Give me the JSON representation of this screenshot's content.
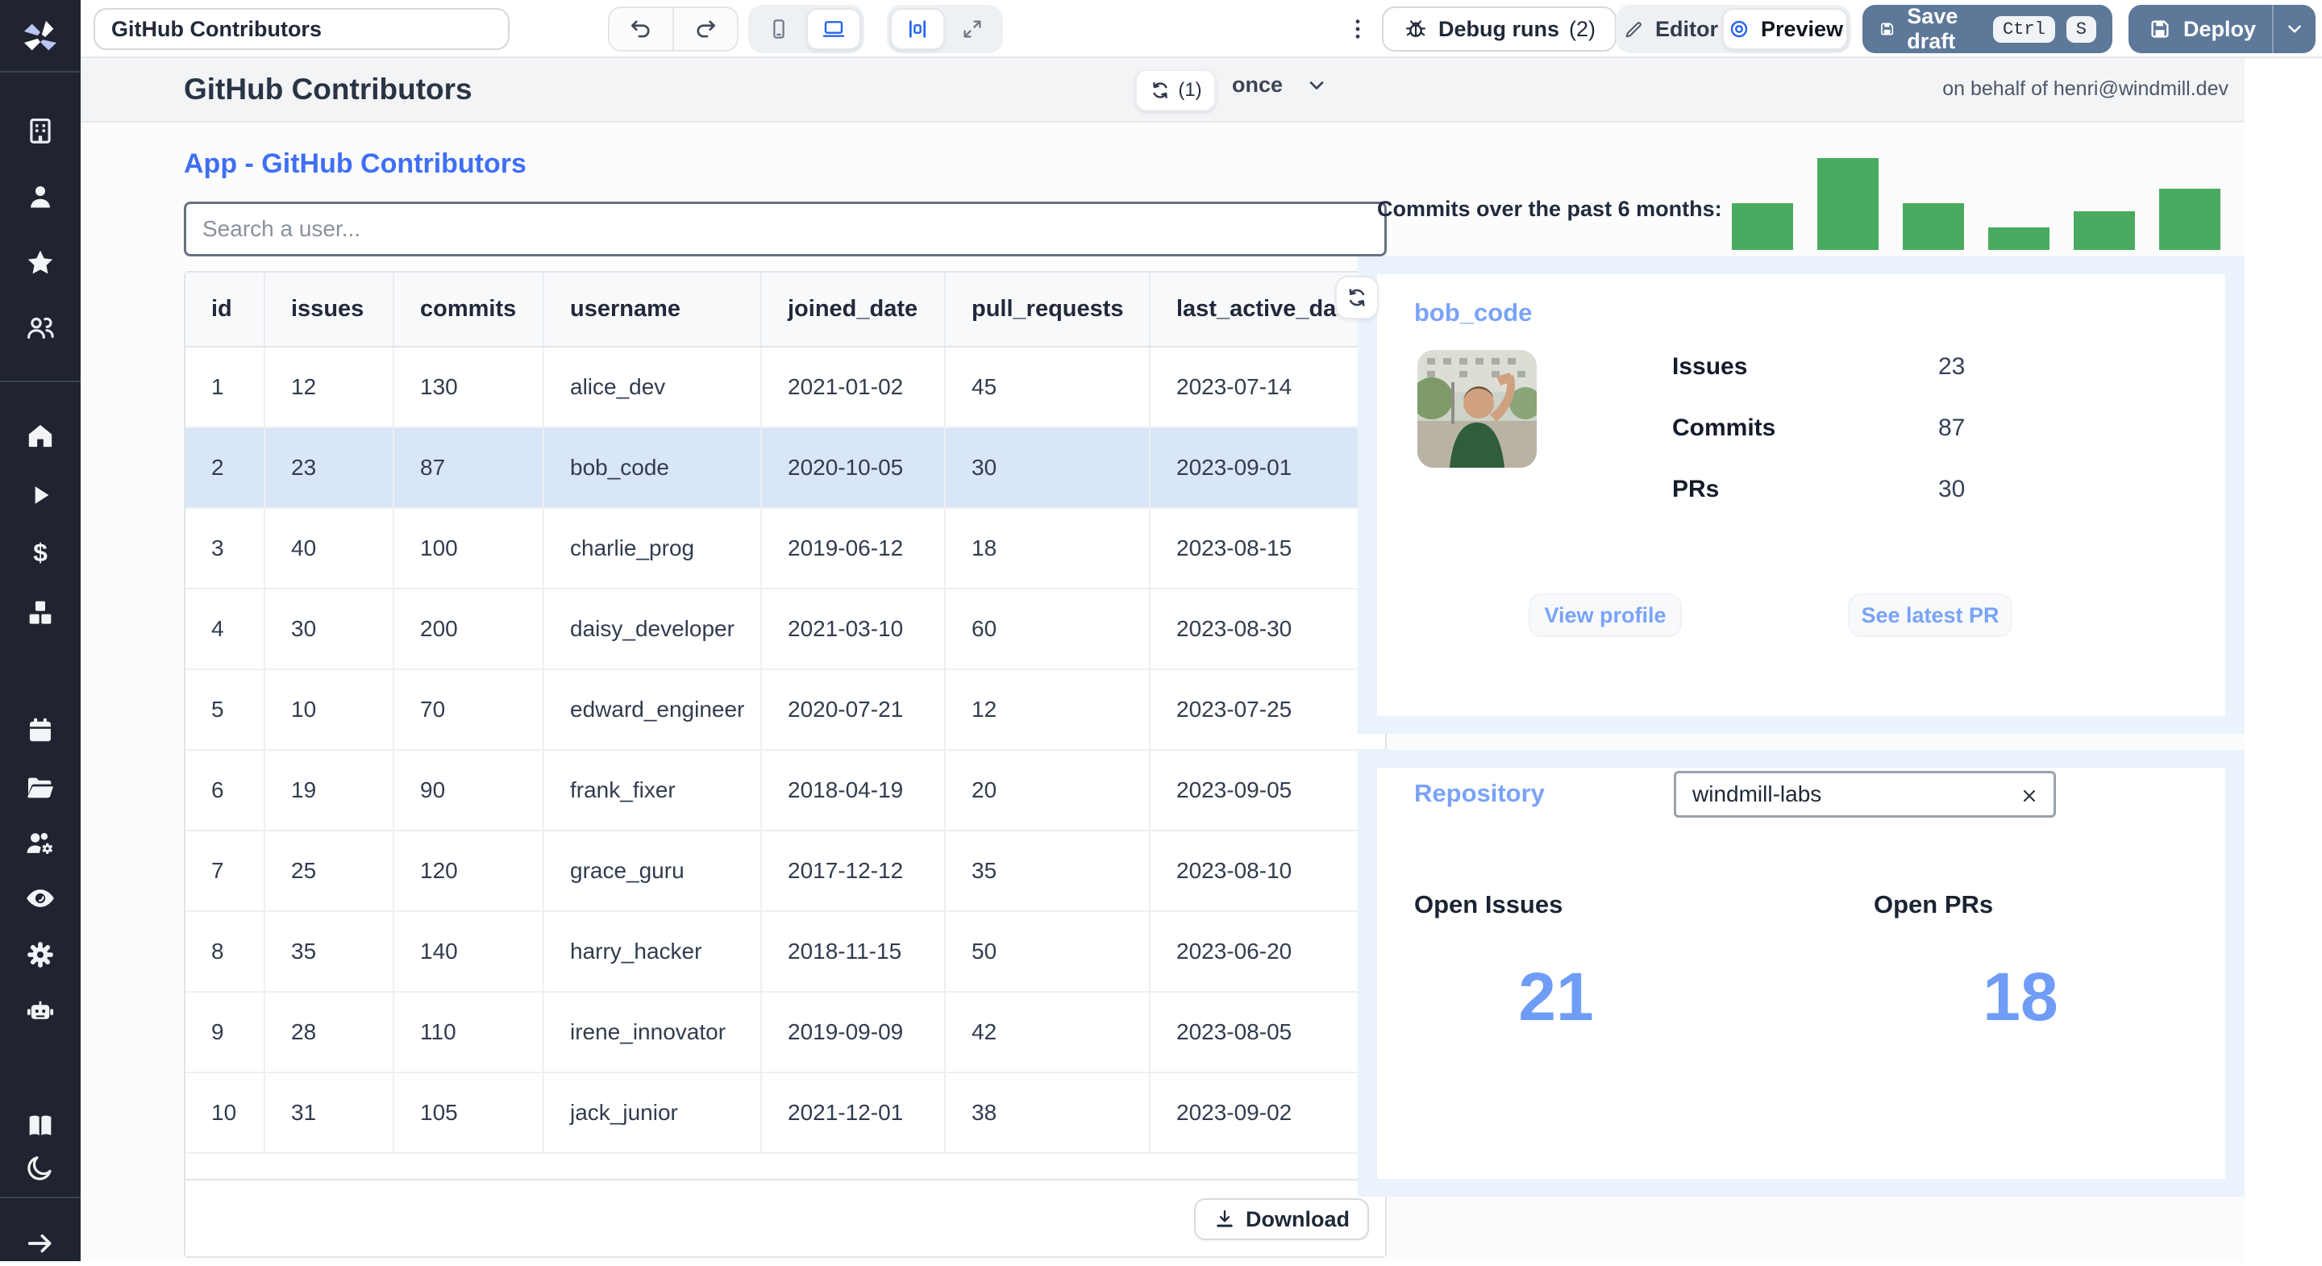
{
  "toolbar": {
    "app_title": "GitHub Contributors",
    "debug_runs_label": "Debug runs",
    "debug_runs_count": "(2)",
    "editor_label": "Editor",
    "preview_label": "Preview",
    "save_draft_label": "Save draft",
    "kbd_keys": [
      "Ctrl",
      "S"
    ],
    "deploy_label": "Deploy",
    "icons": [
      "windmill-logo",
      "undo-icon",
      "redo-icon",
      "mobile-icon",
      "desktop-icon",
      "align-center-icon",
      "expand-icon",
      "kebab-menu-icon",
      "bug-icon",
      "pencil-icon",
      "eye-icon",
      "save-icon",
      "chevron-down-icon"
    ]
  },
  "app_header": {
    "title": "GitHub Contributors",
    "refresh_count": "(1)",
    "schedule_mode": "once",
    "on_behalf_of": "on behalf of henri@windmill.dev"
  },
  "page": {
    "heading": "App - GitHub Contributors",
    "search_placeholder": "Search a user...",
    "download_label": "Download"
  },
  "table": {
    "columns": [
      "id",
      "issues",
      "commits",
      "username",
      "joined_date",
      "pull_requests",
      "last_active_date"
    ],
    "rows": [
      [
        "1",
        "12",
        "130",
        "alice_dev",
        "2021-01-02",
        "45",
        "2023-07-14"
      ],
      [
        "2",
        "23",
        "87",
        "bob_code",
        "2020-10-05",
        "30",
        "2023-09-01"
      ],
      [
        "3",
        "40",
        "100",
        "charlie_prog",
        "2019-06-12",
        "18",
        "2023-08-15"
      ],
      [
        "4",
        "30",
        "200",
        "daisy_developer",
        "2021-03-10",
        "60",
        "2023-08-30"
      ],
      [
        "5",
        "10",
        "70",
        "edward_engineer",
        "2020-07-21",
        "12",
        "2023-07-25"
      ],
      [
        "6",
        "19",
        "90",
        "frank_fixer",
        "2018-04-19",
        "20",
        "2023-09-05"
      ],
      [
        "7",
        "25",
        "120",
        "grace_guru",
        "2017-12-12",
        "35",
        "2023-08-10"
      ],
      [
        "8",
        "35",
        "140",
        "harry_hacker",
        "2018-11-15",
        "50",
        "2023-06-20"
      ],
      [
        "9",
        "28",
        "110",
        "irene_innovator",
        "2019-09-09",
        "42",
        "2023-08-05"
      ],
      [
        "10",
        "31",
        "105",
        "jack_junior",
        "2021-12-01",
        "38",
        "2023-09-02"
      ]
    ],
    "selected_row_index": 1
  },
  "chart_data": {
    "type": "bar",
    "title": "Commits over the past 6 months:",
    "categories": [
      "",
      "",
      "",
      "",
      "",
      ""
    ],
    "values": [
      50,
      100,
      50,
      25,
      42,
      66
    ],
    "ylim": [
      0,
      100
    ],
    "bar_color": "#4aab60",
    "legend": false,
    "axes_visible": false,
    "note": "sparkline-style bars with no axis labels; values estimated from relative bar heights, max normalized to 100"
  },
  "contributor_card": {
    "username": "bob_code",
    "avatar_description": "photo of a person outdoors in a green t-shirt with one arm raised over head",
    "stats": [
      {
        "label": "Issues",
        "value": "23"
      },
      {
        "label": "Commits",
        "value": "87"
      },
      {
        "label": "PRs",
        "value": "30"
      }
    ],
    "buttons": [
      "View profile",
      "See latest PR"
    ]
  },
  "repository": {
    "heading": "Repository",
    "input_value": "windmill-labs",
    "clear_icon": "x-clear-icon",
    "open_issues_label": "Open Issues",
    "open_issues_value": "21",
    "open_prs_label": "Open PRs",
    "open_prs_value": "18"
  },
  "sidebar": {
    "icons": [
      "windmill-logo",
      "building-icon",
      "user-icon",
      "star-icon",
      "users-icon",
      "home-icon",
      "play-icon",
      "dollar-icon",
      "cubes-icon",
      "calendar-icon",
      "folder-icon",
      "users-gear-icon",
      "eye-icon",
      "gear-icon",
      "robot-icon",
      "book-icon",
      "moon-icon",
      "arrow-right-icon"
    ]
  },
  "colors": {
    "accent_blue": "#3f6ff2",
    "link_blue": "#7aa3f8",
    "big_number_blue": "#6f9cf6",
    "bar_green": "#4aab60",
    "selected_row": "#d8e6f7",
    "slate_button": "#5d7899",
    "sidebar_bg": "#1f2430"
  }
}
